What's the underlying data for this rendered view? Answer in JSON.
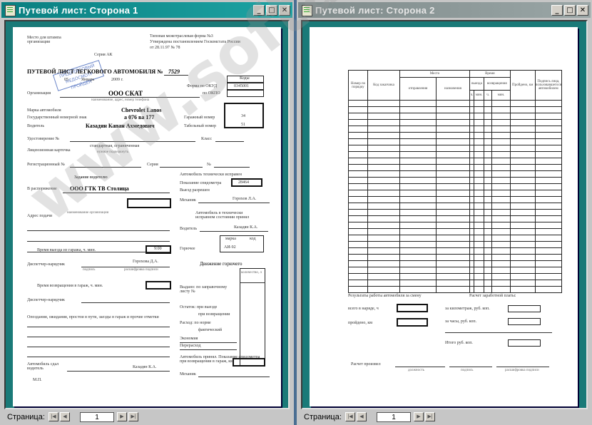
{
  "window1": {
    "title": "Путевой лист: Сторона 1",
    "status_label": "Страница:",
    "page_number": "1",
    "form": {
      "place": "Место для штампа организации",
      "stamp_text": "ПРЕДРЕЙСОВЫЙ МЕДОСМОТР ПРОЙДЕН",
      "series": "Серия АК",
      "std_form": "Типовая межотраслевая форма №3",
      "approved": "Утверждена постановлением Госкомстата России",
      "approved_date": "от 28.11.97 № 78",
      "doc_title": "ПУТЕВОЙ ЛИСТ ЛЕГКОВОГО АВТОМОБИЛЯ №",
      "doc_number": "7529",
      "day": "05",
      "month": "Январь",
      "year": "2009 г.",
      "codes_label": "Коды",
      "okud_label": "Форма по ОКУД",
      "okud_code": "0345001",
      "org_label": "Организация",
      "org_value": "ООО СКАТ",
      "okpo_label": "по ОКПО",
      "org_hint": "наименование, адрес, номер телефона",
      "car_label": "Марка автомобиля",
      "car_value": "Chevrolet Lanos",
      "plate_label": "Государственный номерной знак",
      "plate_value": "а 076 ва 177",
      "garage_label": "Гаражный номер",
      "garage_value": "34",
      "driver_label": "Водитель",
      "driver_value": "Казадян Капан Ахмедович",
      "tab_label": "Табельный номер",
      "tab_value": "51",
      "license_label": "Удостоверение №",
      "class_label": "Класс",
      "lic_card_label": "Лицензионная карточка",
      "lic_card_value": "стандартная, ограниченная",
      "lic_card_hint": "нужное подчеркнуть",
      "reg_label": "Регистрационный №",
      "serial_label": "Серия",
      "num_label": "№",
      "task_header": "Задание водителю",
      "tech_ok": "Автомобиль технически исправен",
      "odo_label": "Показание спидометра",
      "odo_value": "28464",
      "departure_allowed": "Выезд разрешен",
      "mechanic_label": "Механик",
      "mechanic_sig": "Горохов Л.А.",
      "disposal_label": "В распоряжение",
      "disposal_value": "ООО ГТК ТВ Столица",
      "org_hint2": "наименование организации",
      "accepted": "Автомобиль в технически исправном состоянии принял",
      "driver_sig_label": "Водитель",
      "driver_sig": "Казадян К.А.",
      "address_label": "Адрес подачи",
      "brand_label": "марка",
      "code_label": "код",
      "fuel_mark": "АИ-92",
      "fuel_label": "Горючее",
      "exit_time_label": "Время выезда из гаража, ч. мин.",
      "exit_time": "9:00",
      "dispatcher_label": "Диспетчер-нарядчик",
      "dispatcher_sig": "Горохова Д.А.",
      "fuel_move": "Движение горючего",
      "quantity": "количество, л",
      "issued": "Выдано: по заправочному листу №",
      "remain_out": "Остаток: при выезде",
      "remain_in": "при возвращении",
      "spend_norm": "Расход: по норме",
      "spend_fact": "фактический",
      "economy": "Экономия",
      "overrun": "Перерасход",
      "return_time": "Время возвращения в гараж, ч. мин.",
      "delays": "Опоздания, ожидания, простои в пути, заезды в гараж и прочие отметки",
      "handed_over": "Автомобиль сдал водитель",
      "received": "Автомобиль принял. Показание спидометра при возвращении в гараж, км",
      "sign_hint": "подпись",
      "decode_hint": "расшифровка подписи",
      "mp": "М.П.",
      "bottom_driver": "Казадян К.А."
    }
  },
  "window2": {
    "title": "Путевой лист: Сторона 2",
    "status_label": "Страница:",
    "page_number": "1",
    "form": {
      "col_num": "Номер по порядку",
      "col_client": "Код заказчика",
      "col_place": "Место",
      "col_depart": "отправления",
      "col_dest": "назначения",
      "col_time": "Время",
      "col_out": "выезда",
      "col_ret": "возвращения",
      "col_h": "ч.",
      "col_min": "мин.",
      "col_km": "Пройдено, км",
      "col_sign": "Подпись лица, пользовавшегося автомобилем",
      "results": "Результаты работы автомобиля за смену",
      "in_duty": "всего в наряде, ч",
      "travelled": "пройдено, км",
      "pay_calc": "Расчет заработной платы:",
      "per_km": "за километраж, руб. коп.",
      "per_hours": "за часы, руб. коп.",
      "total": "Итого руб. коп.",
      "calc_by": "Расчет произвел",
      "position": "должность",
      "sign": "подпись",
      "decode": "расшифровка подписи"
    }
  },
  "watermark": "www.softandweb.ru"
}
